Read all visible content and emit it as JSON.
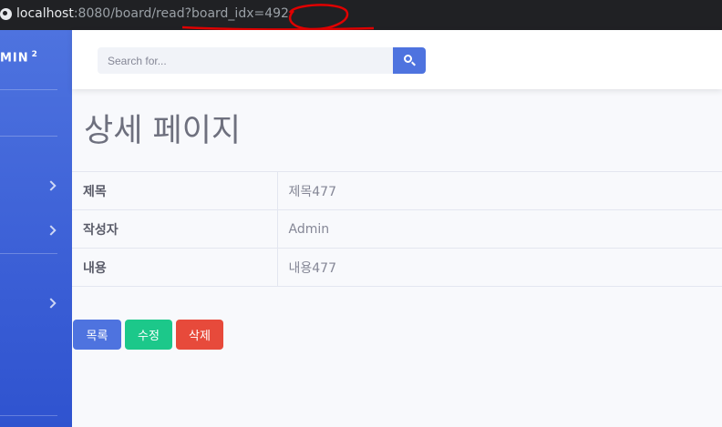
{
  "browser": {
    "url_host": "localhost",
    "url_rest": ":8080/board/read?board_idx=492",
    "annotation_color": "#e00000"
  },
  "sidebar": {
    "brand_text": "MIN",
    "brand_sup": "2"
  },
  "search": {
    "placeholder": "Search for..."
  },
  "page": {
    "title": "상세 페이지"
  },
  "detail": {
    "rows": [
      {
        "label": "제목",
        "value": "제목477"
      },
      {
        "label": "작성자",
        "value": "Admin"
      },
      {
        "label": "내용",
        "value": "내용477"
      }
    ]
  },
  "actions": {
    "list_label": "목록",
    "edit_label": "수정",
    "delete_label": "삭제"
  },
  "colors": {
    "primary": "#4e73df",
    "success": "#1cc88a",
    "danger": "#e74a3b"
  }
}
